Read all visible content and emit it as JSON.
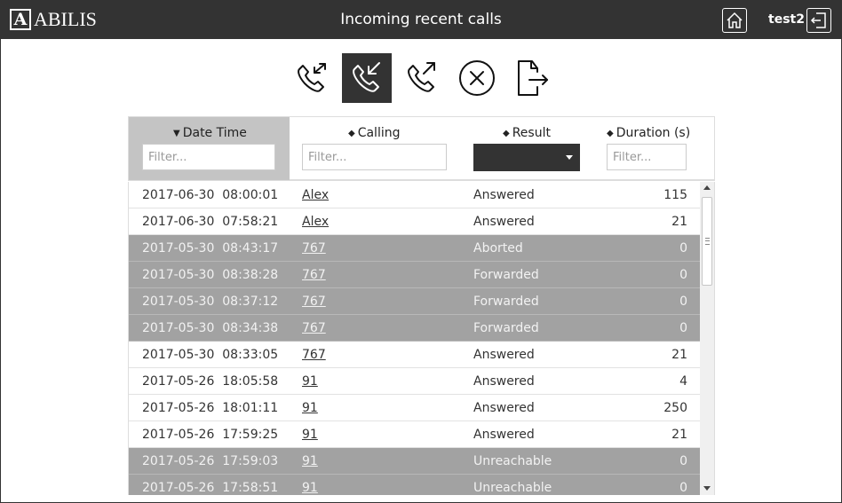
{
  "header": {
    "logo_letter": "A",
    "logo_text": "ABILIS",
    "title": "Incoming recent calls",
    "user": "test2"
  },
  "toolbar": {
    "buttons": [
      {
        "icon": "phone-all-calls-icon",
        "active": false
      },
      {
        "icon": "phone-incoming-icon",
        "active": true
      },
      {
        "icon": "phone-outgoing-icon",
        "active": false
      },
      {
        "icon": "circle-x-icon",
        "active": false
      },
      {
        "icon": "file-export-icon",
        "active": false
      }
    ]
  },
  "columns": {
    "date": {
      "label": "Date Time",
      "placeholder": "Filter...",
      "sort": "desc"
    },
    "calling": {
      "label": "Calling",
      "placeholder": "Filter...",
      "sort": "both"
    },
    "result": {
      "label": "Result",
      "sort": "both",
      "selected": ""
    },
    "duration": {
      "label": "Duration (s)",
      "placeholder": "Filter...",
      "sort": "both"
    }
  },
  "rows": [
    {
      "date": "2017-06-30  08:00:01",
      "calling": "Alex",
      "result": "Answered",
      "duration": "115",
      "dim": false
    },
    {
      "date": "2017-06-30  07:58:21",
      "calling": "Alex",
      "result": "Answered",
      "duration": "21",
      "dim": false
    },
    {
      "date": "2017-05-30  08:43:17",
      "calling": "767",
      "result": "Aborted",
      "duration": "0",
      "dim": true
    },
    {
      "date": "2017-05-30  08:38:28",
      "calling": "767",
      "result": "Forwarded",
      "duration": "0",
      "dim": true
    },
    {
      "date": "2017-05-30  08:37:12",
      "calling": "767",
      "result": "Forwarded",
      "duration": "0",
      "dim": true
    },
    {
      "date": "2017-05-30  08:34:38",
      "calling": "767",
      "result": "Forwarded",
      "duration": "0",
      "dim": true
    },
    {
      "date": "2017-05-30  08:33:05",
      "calling": "767",
      "result": "Answered",
      "duration": "21",
      "dim": false
    },
    {
      "date": "2017-05-26  18:05:58",
      "calling": "91",
      "result": "Answered",
      "duration": "4",
      "dim": false
    },
    {
      "date": "2017-05-26  18:01:11",
      "calling": "91",
      "result": "Answered",
      "duration": "250",
      "dim": false
    },
    {
      "date": "2017-05-26  17:59:25",
      "calling": "91",
      "result": "Answered",
      "duration": "21",
      "dim": false
    },
    {
      "date": "2017-05-26  17:59:03",
      "calling": "91",
      "result": "Unreachable",
      "duration": "0",
      "dim": true
    },
    {
      "date": "2017-05-26  17:58:51",
      "calling": "91",
      "result": "Unreachable",
      "duration": "0",
      "dim": true
    }
  ],
  "colors": {
    "header_bg": "#333333",
    "dim_row_bg": "#a2a2a2",
    "sorted_col_bg": "#c4c4c4"
  }
}
